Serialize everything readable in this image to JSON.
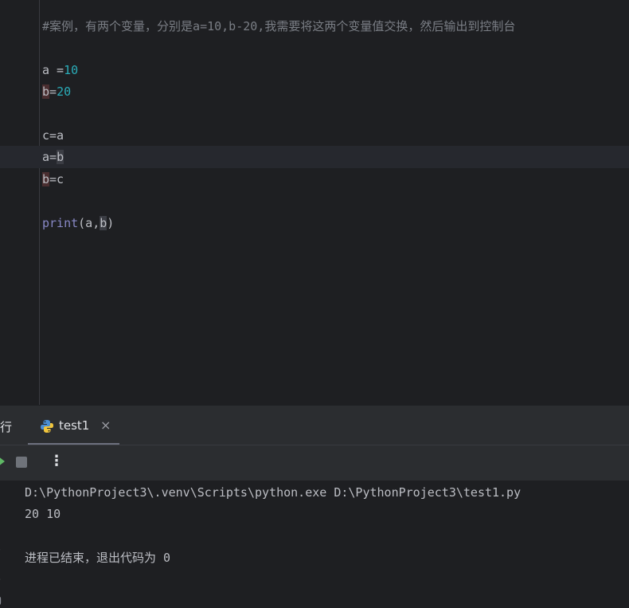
{
  "editor": {
    "lines": {
      "comment": "#案例，有两个变量，分别是a=10,b-20,我需要将这两个变量值交换，然后输出到控制台",
      "l1_a": "a =",
      "l1_val": "10",
      "l2_b": "b",
      "l2_eq": "=",
      "l2_val": "20",
      "l3": "c=a",
      "l4_a": "a=",
      "l4_b": "b",
      "l5_b": "b",
      "l5_rest": "=c",
      "l6_fn": "print",
      "l6_args": "(a,",
      "l6_b": "b",
      "l6_close": ")"
    }
  },
  "run_panel": {
    "title": "运行",
    "title_visible": "行",
    "tab_label": "test1",
    "close_glyph": "×",
    "more_glyph": "⋮",
    "console": {
      "command": "D:\\PythonProject3\\.venv\\Scripts\\python.exe D:\\PythonProject3\\test1.py",
      "output": "20 10",
      "exit_message": "进程已结束，退出代码为 0"
    }
  }
}
